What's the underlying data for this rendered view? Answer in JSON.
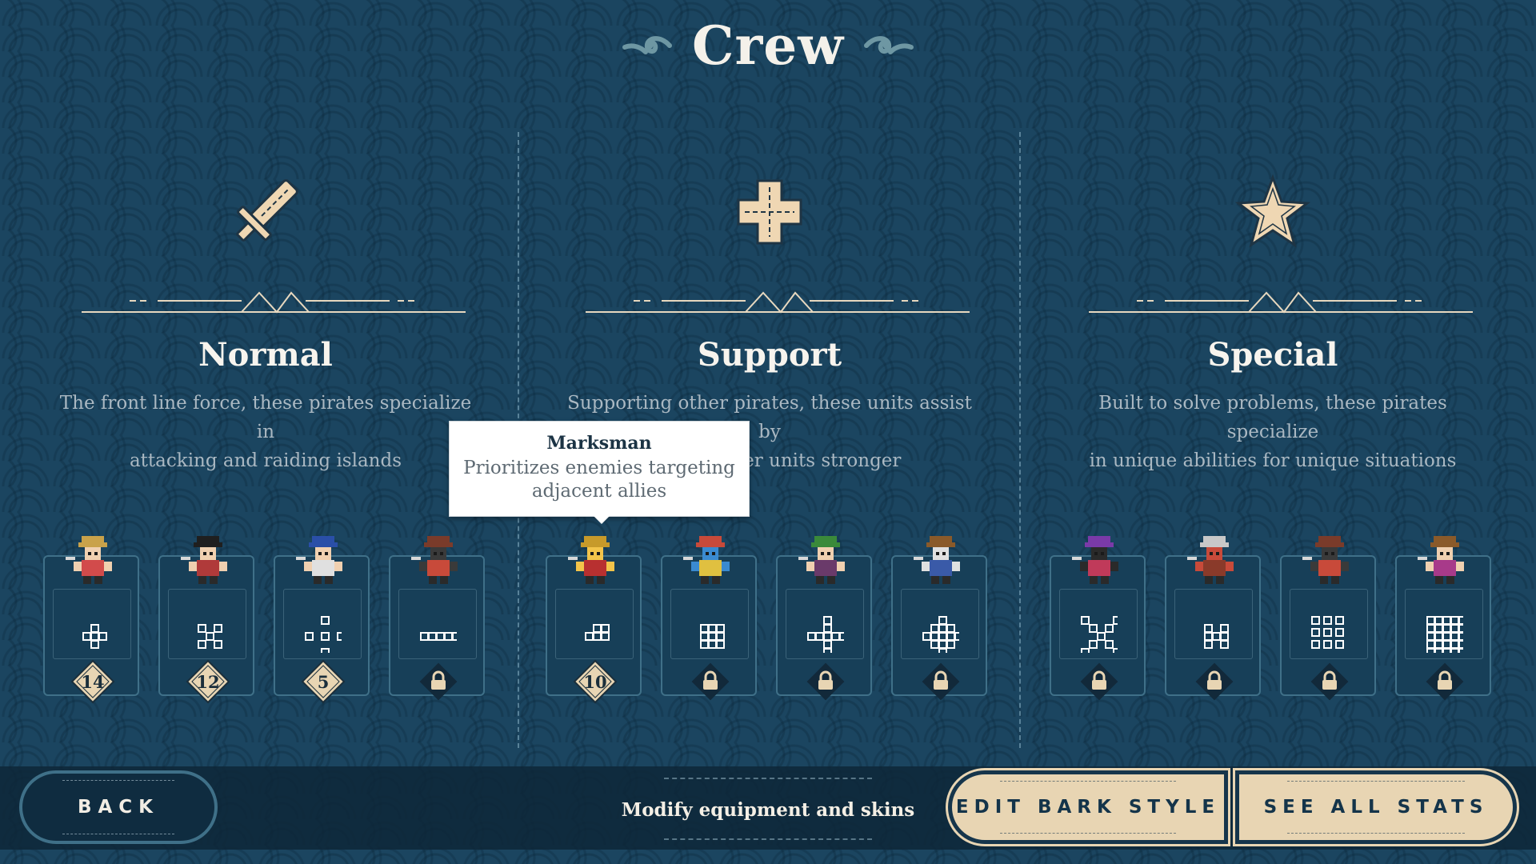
{
  "header": {
    "title": "Crew"
  },
  "columns": [
    {
      "key": "normal",
      "title": "Normal",
      "icon": "sword-icon",
      "description_line1": "The front line force, these pirates specialize in",
      "description_line2": "attacking and raiding islands"
    },
    {
      "key": "support",
      "title": "Support",
      "icon": "cross-icon",
      "description_line1": "Supporting other pirates, these units assist by",
      "description_line2": "making other units stronger"
    },
    {
      "key": "special",
      "title": "Special",
      "icon": "star-icon",
      "description_line1": "Built to solve problems, these pirates specialize",
      "description_line2": "in unique abilities for unique situations"
    }
  ],
  "units": [
    {
      "id": "normal-1",
      "sprite": "pirate-captain-sprite",
      "pattern": "cross-pattern-icon",
      "count": "14",
      "locked": false
    },
    {
      "id": "normal-2",
      "sprite": "pirate-flag-bearer-sprite",
      "pattern": "x-pattern-icon",
      "count": "12",
      "locked": false
    },
    {
      "id": "normal-3",
      "sprite": "pirate-musketeer-sprite",
      "pattern": "spread-cross-pattern-icon",
      "count": "5",
      "locked": false
    },
    {
      "id": "normal-4",
      "sprite": "pirate-cannoneer-sprite",
      "pattern": "horizontal-line-pattern-icon",
      "count": "",
      "locked": true
    },
    {
      "id": "support-1",
      "sprite": "pirate-marksman-sprite",
      "pattern": "corner-pattern-icon",
      "count": "10",
      "locked": false
    },
    {
      "id": "support-2",
      "sprite": "pirate-parrot-sprite",
      "pattern": "grid-pattern-icon",
      "count": "",
      "locked": true
    },
    {
      "id": "support-3",
      "sprite": "pirate-harpooner-sprite",
      "pattern": "plus-pattern-icon",
      "count": "",
      "locked": true
    },
    {
      "id": "support-4",
      "sprite": "pirate-swordsman-sprite",
      "pattern": "diamond-pattern-icon",
      "count": "",
      "locked": true
    },
    {
      "id": "special-1",
      "sprite": "pirate-witch-sprite",
      "pattern": "big-x-pattern-icon",
      "count": "",
      "locked": true
    },
    {
      "id": "special-2",
      "sprite": "pirate-gunner-sprite",
      "pattern": "block-pattern-icon",
      "count": "",
      "locked": true
    },
    {
      "id": "special-3",
      "sprite": "pirate-cannon-crew-sprite",
      "pattern": "ring-pattern-icon",
      "count": "",
      "locked": true
    },
    {
      "id": "special-4",
      "sprite": "pirate-barrel-sprite",
      "pattern": "full-grid-pattern-icon",
      "count": "",
      "locked": true
    }
  ],
  "tooltip": {
    "title": "Marksman",
    "line1": "Prioritizes enemies targeting",
    "line2": "adjacent allies"
  },
  "footer": {
    "back_label": "BACK",
    "hint": "Modify equipment and skins",
    "edit_label": "EDIT BARK STYLE",
    "stats_label": "SEE ALL STATS"
  },
  "colors": {
    "background": "#1b4560",
    "panel": "#173f58",
    "tan": "#e8d5b3",
    "text": "#f2e6cf"
  }
}
